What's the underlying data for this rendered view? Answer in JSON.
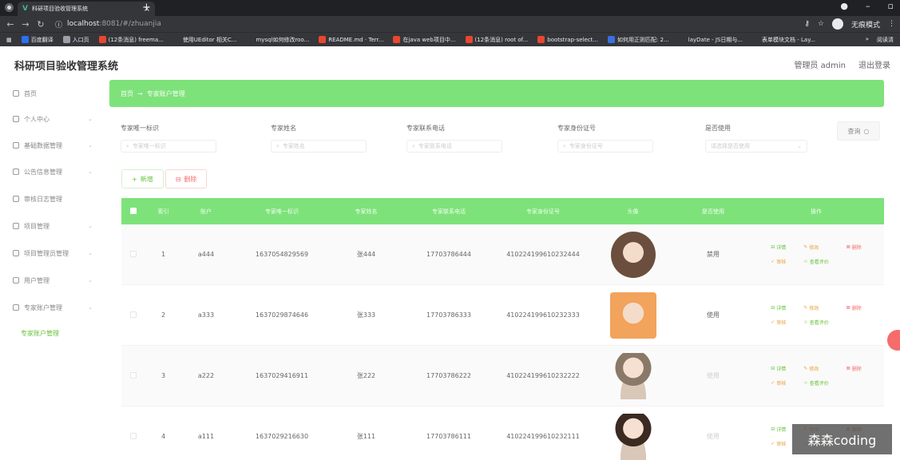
{
  "browser": {
    "tab_title": "科研项目验收管理系统",
    "tab_close": "×",
    "new_tab": "+",
    "url_host": "localhost",
    "url_path": ":8081/#/zhuanjia",
    "incognito_label": "无痕模式",
    "bookmarks": [
      {
        "label": "百度翻译",
        "color": "#2b6ff2"
      },
      {
        "label": "入口页",
        "color": "#9aa0a6"
      },
      {
        "label": "(12条消息) freema...",
        "color": "#e8462f"
      },
      {
        "label": "使用UEditor 相关C...",
        "color": "#35363a"
      },
      {
        "label": "mysql如何修改roo...",
        "color": "#35363a"
      },
      {
        "label": "README.md · Terr...",
        "color": "#e8462f"
      },
      {
        "label": "在java web项目中...",
        "color": "#e8462f"
      },
      {
        "label": "(12条消息) root of...",
        "color": "#e8462f"
      },
      {
        "label": "bootstrap-select...",
        "color": "#e8462f"
      },
      {
        "label": "如何用正则匹配: 2...",
        "color": "#3b6fe0"
      },
      {
        "label": "layDate - JS日期与...",
        "color": "#35363a"
      },
      {
        "label": "表单模块文档 - Lay...",
        "color": "#35363a"
      }
    ],
    "bookmarks_more": "»",
    "reading_list": "阅读清"
  },
  "app": {
    "title": "科研项目验收管理系统",
    "user_label": "管理员 admin",
    "logout_label": "退出登录"
  },
  "sidebar": {
    "items": [
      {
        "label": "首页",
        "has_arrow": false
      },
      {
        "label": "个人中心",
        "has_arrow": true
      },
      {
        "label": "基础数据管理",
        "has_arrow": true
      },
      {
        "label": "公告信息管理",
        "has_arrow": true
      },
      {
        "label": "审核日志管理",
        "has_arrow": false
      },
      {
        "label": "项目管理",
        "has_arrow": true
      },
      {
        "label": "项目管理员管理",
        "has_arrow": true
      },
      {
        "label": "用户管理",
        "has_arrow": true
      },
      {
        "label": "专家账户管理",
        "has_arrow": true
      }
    ],
    "active_sub": "专家账户管理"
  },
  "breadcrumb": {
    "home": "首页",
    "sep": "→",
    "current": "专家账户管理"
  },
  "filters": [
    {
      "label": "专家唯一标识",
      "placeholder": "专家唯一标识",
      "type": "input"
    },
    {
      "label": "专家姓名",
      "placeholder": "专家姓名",
      "type": "input"
    },
    {
      "label": "专家联系电话",
      "placeholder": "专家联系电话",
      "type": "input"
    },
    {
      "label": "专家身份证号",
      "placeholder": "专家身份证号",
      "type": "input"
    },
    {
      "label": "是否使用",
      "placeholder": "请选择是否使用",
      "type": "select"
    }
  ],
  "search_button": "查询",
  "actions": {
    "add": "新增",
    "delete": "删除"
  },
  "table": {
    "headers": [
      "索引",
      "账户",
      "专家唯一标识",
      "专家姓名",
      "专家联系电话",
      "专家身份证号",
      "头像",
      "是否使用",
      "操作"
    ],
    "rows": [
      {
        "index": "1",
        "account": "a444",
        "uid": "1637054829569",
        "name": "张444",
        "phone": "17703786444",
        "idno": "410224199610232444",
        "status": "禁用",
        "status_clear": true,
        "avatar_color": "#6b4e3d",
        "avatar_shape": "circle",
        "ops": [
          "详情",
          "修改",
          "删除",
          "审核",
          "查看评价"
        ]
      },
      {
        "index": "2",
        "account": "a333",
        "uid": "1637029874646",
        "name": "张333",
        "phone": "17703786333",
        "idno": "410224199610232333",
        "status": "使用",
        "status_clear": true,
        "avatar_color": "#f2a35c",
        "avatar_shape": "square",
        "ops": [
          "详情",
          "修改",
          "删除",
          "审核",
          "查看评价"
        ]
      },
      {
        "index": "3",
        "account": "a222",
        "uid": "1637029416911",
        "name": "张222",
        "phone": "17703786222",
        "idno": "410224199610232222",
        "status": "使用",
        "status_clear": false,
        "avatar_color": "#8a7968",
        "avatar_shape": "figure",
        "ops": [
          "详情",
          "修改",
          "删除",
          "审核",
          "查看评价"
        ]
      },
      {
        "index": "4",
        "account": "a111",
        "uid": "1637029216630",
        "name": "张111",
        "phone": "17703786111",
        "idno": "410224199610232111",
        "status": "使用",
        "status_clear": false,
        "avatar_color": "#3b2a22",
        "avatar_shape": "figure",
        "ops": [
          "详情",
          "修改",
          "删除",
          "审核",
          "查看评价"
        ]
      }
    ]
  },
  "watermark": "森森coding",
  "colors": {
    "accent_green": "#7ee27a",
    "danger": "#f56c6c",
    "warning": "#e6a23c",
    "success": "#67c23a"
  }
}
